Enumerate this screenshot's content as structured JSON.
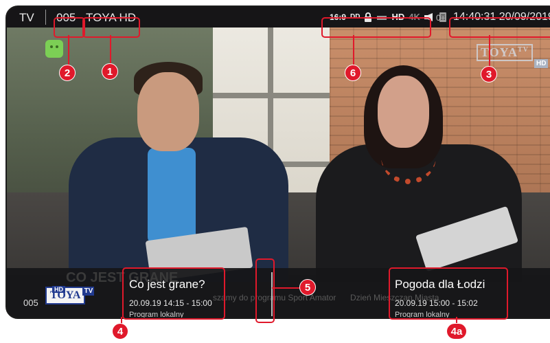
{
  "topbar": {
    "source_label": "TV",
    "channel_number": "005",
    "channel_name": "TOYA HD",
    "aspect_badge": "16:9",
    "audio_badge": "DD",
    "hd_badge": "HD",
    "uhd_badge": "4K",
    "age_rating": "0+",
    "datetime": "14:40:31 20/09/2019",
    "icons": [
      "lock-icon",
      "subtitles-icon",
      "speaker-icon",
      "teletext-icon"
    ]
  },
  "watermark": {
    "logo_text": "TOYA",
    "logo_superscript": "TV",
    "hd_tag": "HD"
  },
  "epg": {
    "channel_number": "005",
    "logo_text": "TOYA",
    "logo_superscript": "TV",
    "logo_hd": "HD",
    "background_title": "CO JEST GRANE",
    "background_ticker_left": "szamy do programu Sport Amator",
    "background_ticker_right": "Dzień Mieszczan Miasta",
    "current": {
      "title": "Co jest grane?",
      "time": "20.09.19 14:15 - 15:00",
      "category": "Program lokalny"
    },
    "next": {
      "title": "Pogoda dla Łodzi",
      "time": "20.09.19 15:00 - 15:02",
      "category": "Program lokalny"
    }
  },
  "annotations": {
    "m1": "1",
    "m2": "2",
    "m3": "3",
    "m4": "4",
    "m4a": "4a",
    "m5": "5",
    "m6": "6"
  },
  "colors": {
    "annotation": "#e0192b",
    "bar_background": "#141416",
    "logo_blue": "#213a8f"
  }
}
